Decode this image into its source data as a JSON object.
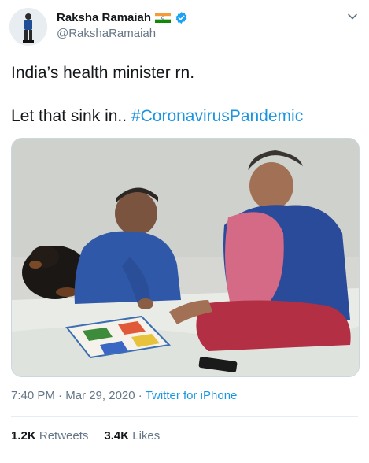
{
  "user": {
    "display_name": "Raksha Ramaiah",
    "handle": "@RakshaRamaiah",
    "flag_icon": "india-flag-icon",
    "verified_icon": "verified-badge-icon"
  },
  "tweet": {
    "line1": "India’s health minister rn.",
    "line2_text": "Let that sink in.. ",
    "hashtag": "#CoronavirusPandemic"
  },
  "meta": {
    "time": "7:40 PM",
    "separator1": " · ",
    "date": "Mar 29, 2020",
    "separator2": " · ",
    "source": "Twitter for iPhone"
  },
  "stats": {
    "retweets_count": "1.2K",
    "retweets_label": "Retweets",
    "likes_count": "3.4K",
    "likes_label": "Likes"
  },
  "colors": {
    "link": "#1b95e0",
    "secondary_text": "#657786",
    "verified": "#1da1f2"
  }
}
